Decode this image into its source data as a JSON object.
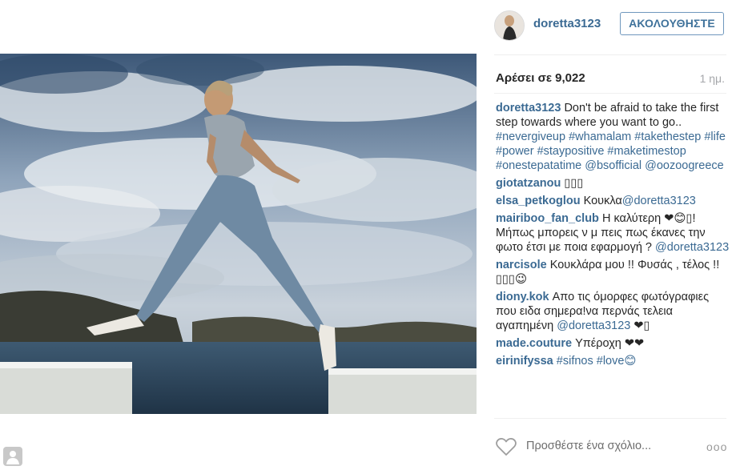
{
  "post": {
    "username": "doretta3123",
    "follow_label": "ΑΚΟΛΟΥΘΗΣΤΕ",
    "likes_text": "Αρέσει σε 9,022",
    "time_ago": "1 ημ.",
    "add_comment_placeholder": "Προσθέστε ένα σχόλιο...",
    "more_label": "ooo"
  },
  "caption": {
    "user": "doretta3123",
    "text": "Don't be afraid to take the first step towards where you want to go..",
    "tags_line1": "#nevergiveup #whamalam #takethestep #life #power #staypositive #maketimestop #onestepatatime @bsofficial @oozoogreece"
  },
  "comments": [
    {
      "user": "giotatzanou",
      "text": "▯▯▯"
    },
    {
      "user": "elsa_petkoglou",
      "text": "Κουκλα",
      "mention": "@doretta3123"
    },
    {
      "user": "mairiboo_fan_club",
      "text": "Η καλύτερη ❤😊▯! Μήπως μπορεις ν μ πεις πως έκανες την φωτο έτσι με ποια εφαρμογή ?",
      "mention": "@doretta3123"
    },
    {
      "user": "narcisole",
      "text": "Κουκλάρα μου !! Φυσάς , τέλος !! ▯▯▯😉"
    },
    {
      "user": "diony.kok",
      "text": "Απο τις όμορφες φωτόγραφιες που ειδα σημερα!να περνάς τελεια αγαπημένη",
      "mention": "@doretta3123",
      "tail": "❤▯"
    },
    {
      "user": "made.couture",
      "text": "Υπέροχη ❤❤"
    },
    {
      "user": "eirinifyssa",
      "tags": "#sifnos #love😊"
    }
  ],
  "icons": {
    "heart": "heart-outline-icon",
    "more": "more-options-icon"
  }
}
